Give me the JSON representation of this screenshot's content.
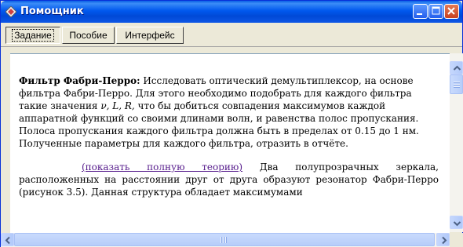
{
  "window": {
    "title": "Помощник"
  },
  "title_buttons": {
    "minimize": "minimize-icon",
    "maximize": "maximize-icon",
    "close": "close-icon"
  },
  "tabs": [
    {
      "label": "Задание",
      "active": true
    },
    {
      "label": "Пособие",
      "active": false
    },
    {
      "label": "Интерфейс",
      "active": false
    }
  ],
  "content": {
    "para1_bold": "Фильтр Фабри-Перро:",
    "para1_text": " Исследовать оптический демультиплексор, на основе фильтра Фабри-Перро. Для этого необходимо подобрать для каждого фильтра такие значения ",
    "para1_vars": "ν, L, R,",
    "para1_text2": " что бы добиться совпадения максимумов каждой аппаратной функций со своими длинами волн, и равенства полос пропускания. Полоса пропускания каждого фильтра должна быть в пределах от 0.15 до 1 нм. Полученные параметры для каждого фильтра, отразить в отчёте.",
    "link_text": "(показать полную теорию)",
    "para2_text": " Два полупрозрачных зеркала, расположенных на расстоянии друг от друга образуют резонатор Фабри-Перро (рисунок 3.5). Данная структура обладает максимумами"
  },
  "colors": {
    "titlebar": "#0058ee",
    "link": "#551a8b",
    "scrollbar": "#b6cdfa"
  }
}
